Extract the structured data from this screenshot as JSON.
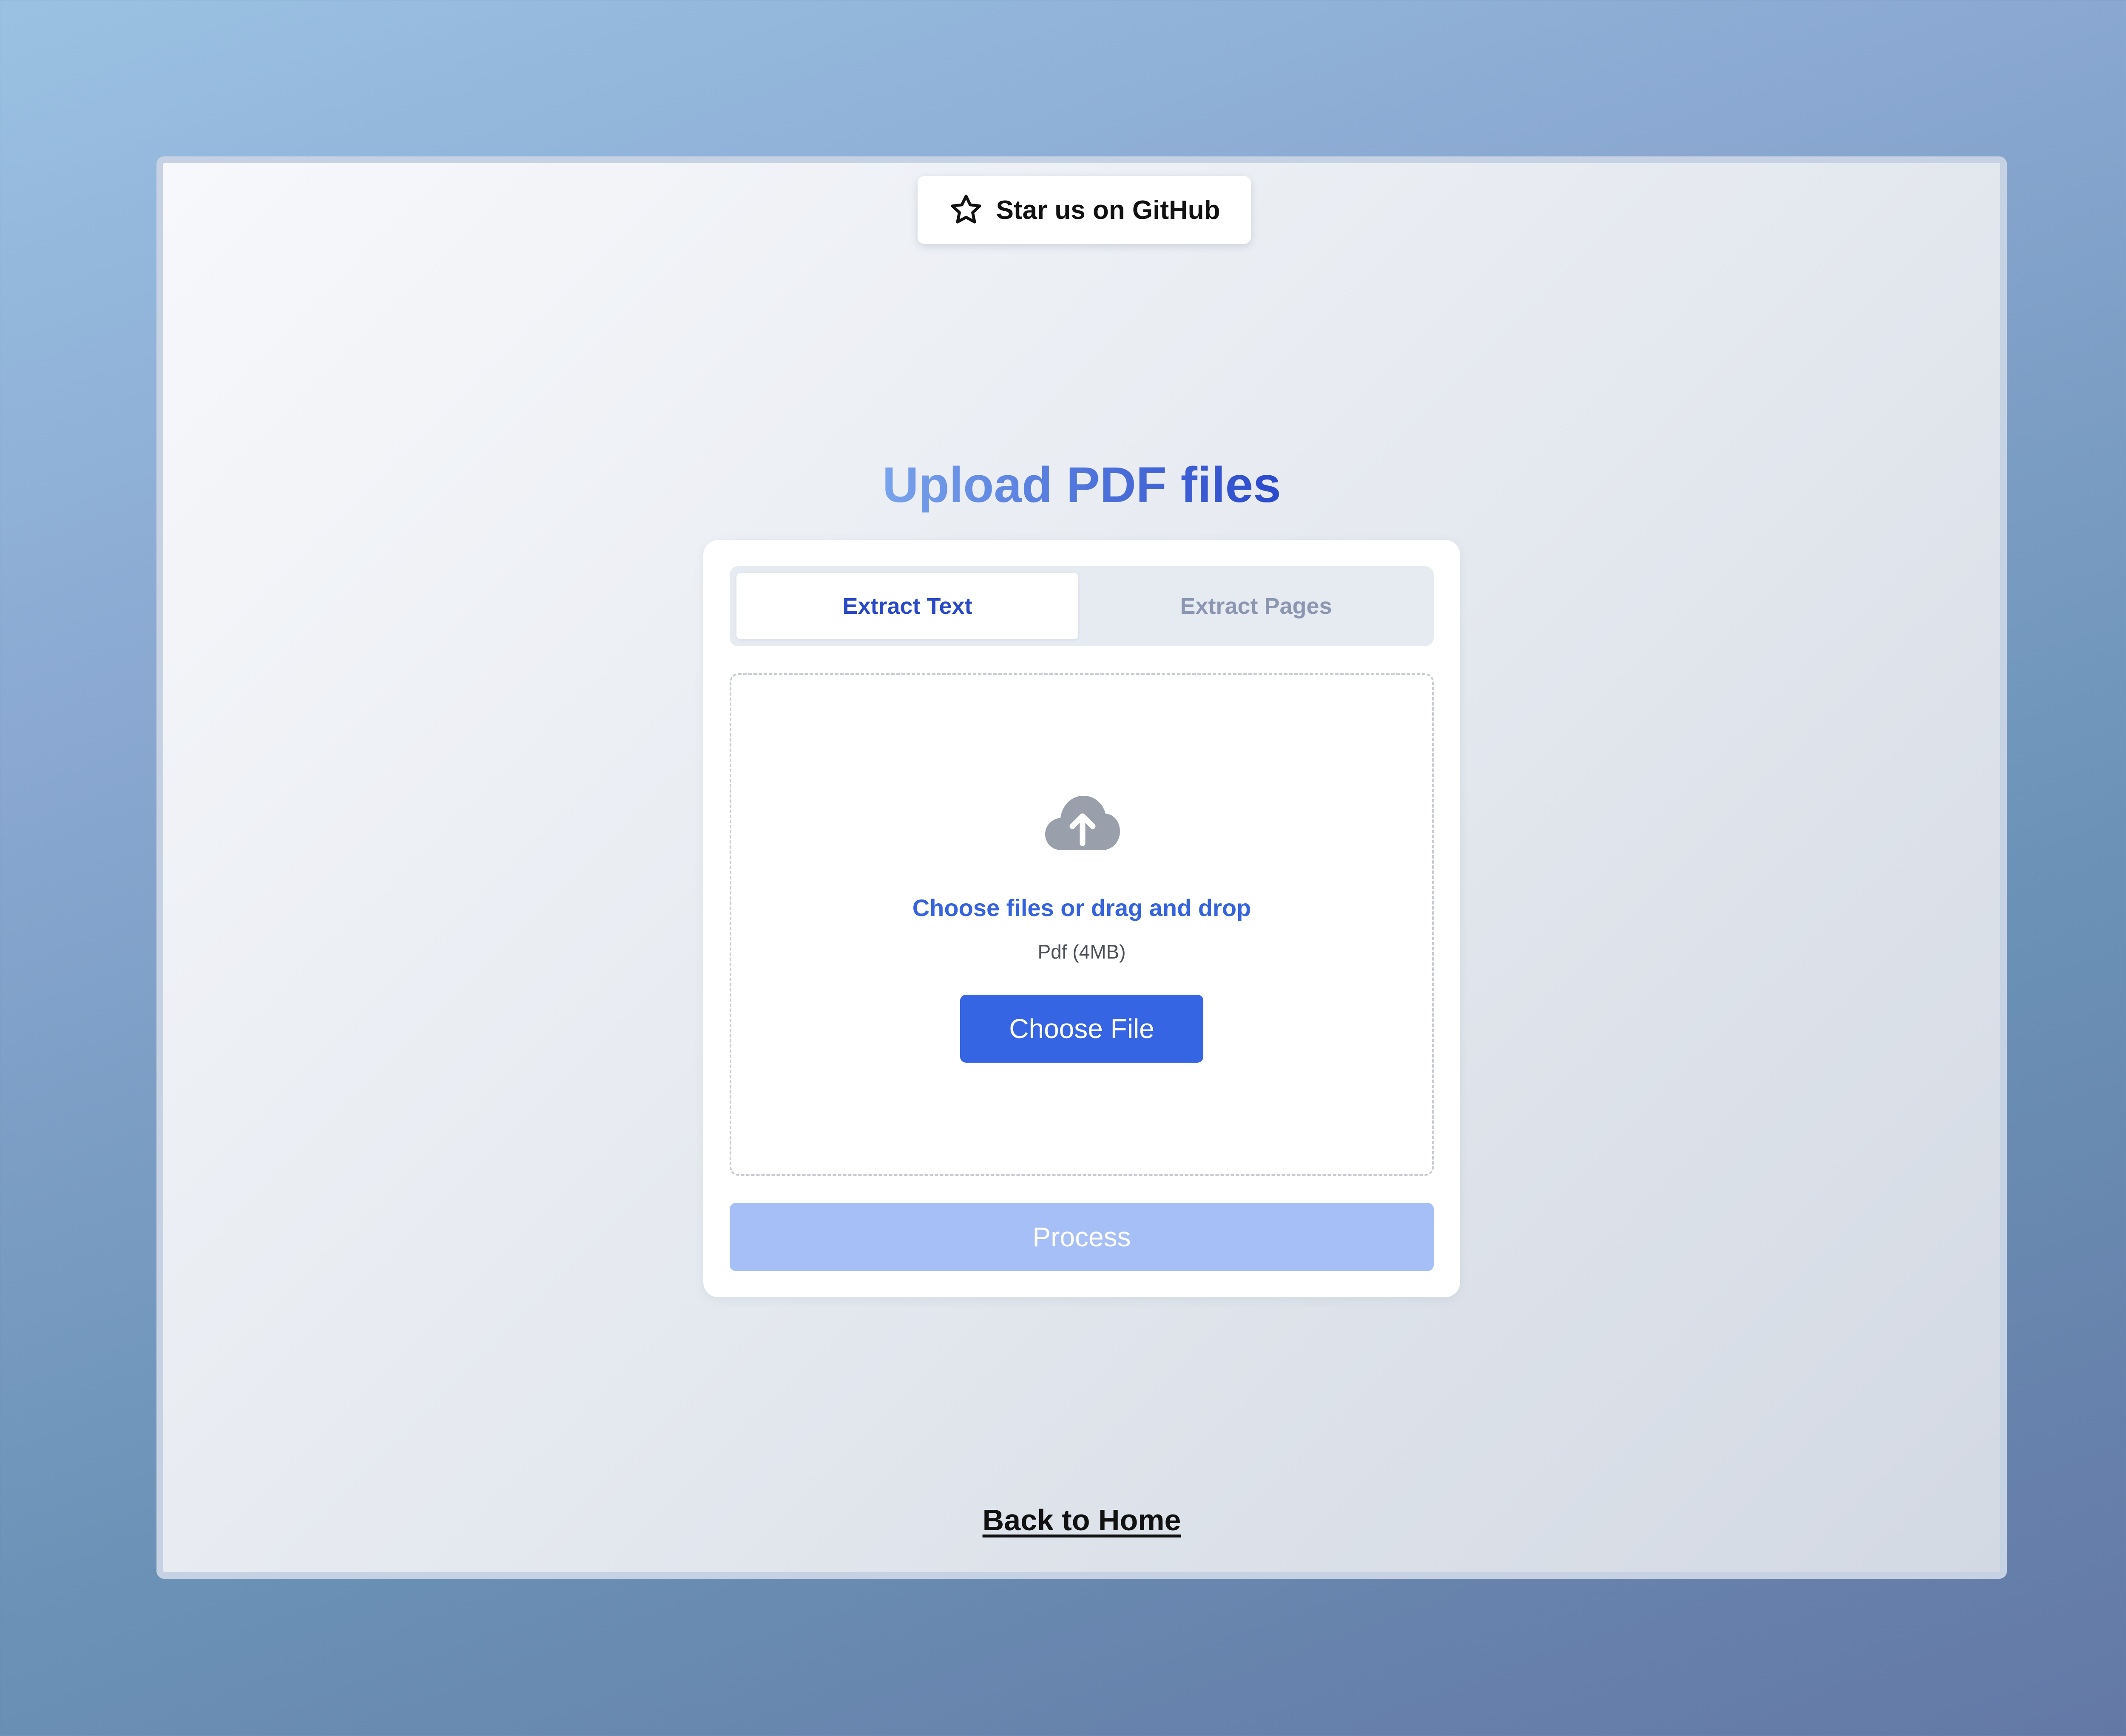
{
  "github": {
    "label": "Star us on GitHub",
    "icon": "star-icon"
  },
  "page": {
    "title": "Upload PDF files",
    "back_label": "Back to Home"
  },
  "tabs": {
    "items": [
      {
        "label": "Extract Text",
        "active": true
      },
      {
        "label": "Extract Pages",
        "active": false
      }
    ]
  },
  "dropzone": {
    "icon": "cloud-upload-icon",
    "title": "Choose files or drag and drop",
    "subtitle": "Pdf (4MB)",
    "button_label": "Choose File"
  },
  "actions": {
    "process_label": "Process"
  },
  "colors": {
    "primary": "#3665e4",
    "primary_disabled": "#a6bff6",
    "title_gradient_start": "#78a3ec",
    "title_gradient_end": "#2a48cc",
    "icon_gray": "#9aa0ab"
  }
}
